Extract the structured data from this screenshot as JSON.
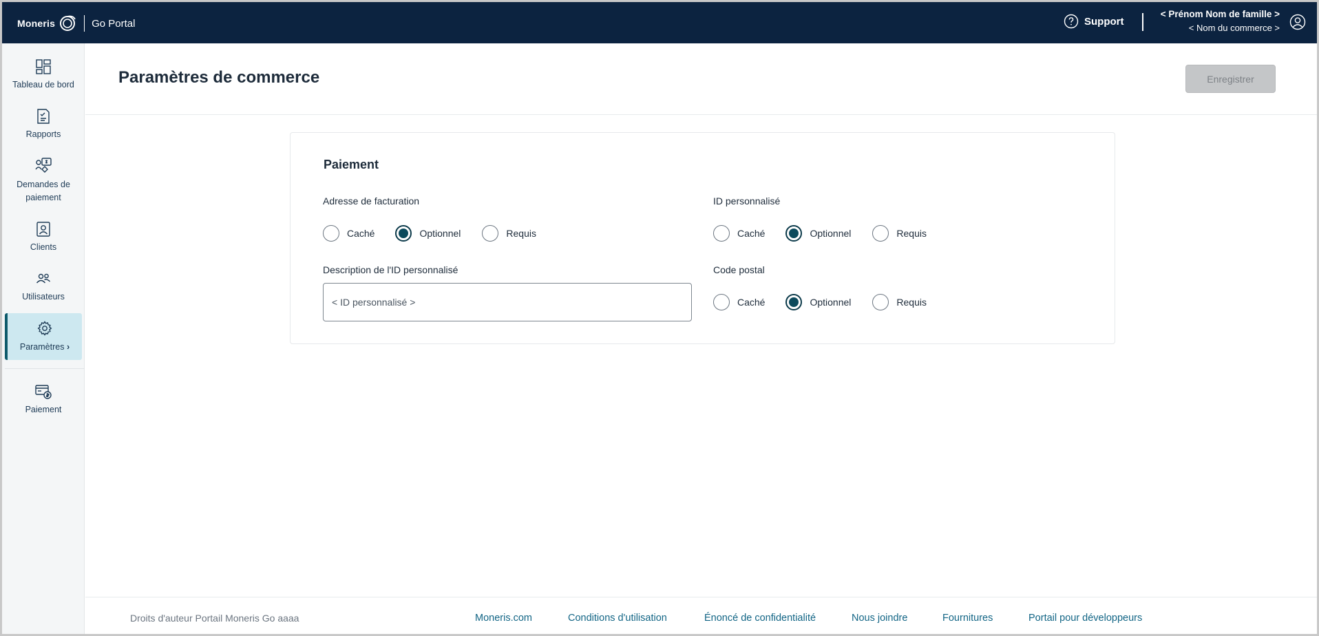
{
  "header": {
    "logo_text": "Moneris",
    "product_name": "Go Portal",
    "support_label": "Support",
    "user_name": "< Prénom Nom de famille >",
    "business_name": "< Nom du commerce >"
  },
  "sidebar": {
    "items": [
      {
        "label": "Tableau de bord",
        "icon": "dashboard-icon"
      },
      {
        "label": "Rapports",
        "icon": "reports-icon"
      },
      {
        "label": "Demandes de paiement",
        "icon": "payment-request-icon"
      },
      {
        "label": "Clients",
        "icon": "clients-icon"
      },
      {
        "label": "Utilisateurs",
        "icon": "users-icon"
      },
      {
        "label": "Paramètres",
        "icon": "gear-icon",
        "active": true
      },
      {
        "label": "Paiement",
        "icon": "payment-icon"
      }
    ]
  },
  "page": {
    "title": "Paramètres de commerce",
    "save_label": "Enregistrer"
  },
  "card": {
    "title": "Paiement",
    "billing_address": {
      "label": "Adresse de facturation",
      "options": [
        "Caché",
        "Optionnel",
        "Requis"
      ],
      "selected": "Optionnel"
    },
    "custom_id": {
      "label": "ID personnalisé",
      "options": [
        "Caché",
        "Optionnel",
        "Requis"
      ],
      "selected": "Optionnel"
    },
    "custom_id_description": {
      "label": "Description de l'ID personnalisé",
      "placeholder": "< ID personnalisé >"
    },
    "postal_code": {
      "label": "Code postal",
      "options": [
        "Caché",
        "Optionnel",
        "Requis"
      ],
      "selected": "Optionnel"
    }
  },
  "footer": {
    "copyright": "Droits d'auteur Portail Moneris Go aaaa",
    "links": [
      "Moneris.com",
      "Conditions d'utilisation",
      "Énoncé de confidentialité",
      "Nous joindre",
      "Fournitures",
      "Portail pour développeurs"
    ]
  },
  "colors": {
    "topbar": "#0c2340",
    "accent": "#0c4a5c",
    "active_nav": "#cde8f0",
    "link": "#126585"
  }
}
